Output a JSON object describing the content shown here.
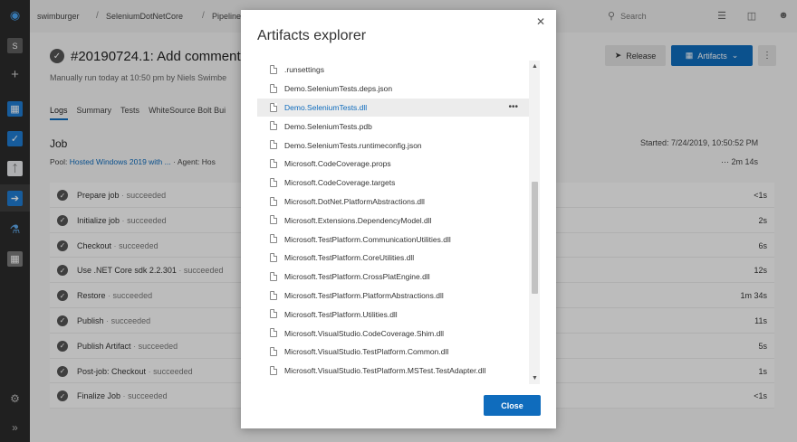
{
  "topbar": {
    "breadcrumbs": [
      "swimburger",
      "SeleniumDotNetCore",
      "Pipelines"
    ],
    "search_placeholder": "Search"
  },
  "run": {
    "title": "#20190724.1: Add comments t",
    "subtitle": "Manually run today at 10:50 pm by Niels Swimbe",
    "release_label": "Release",
    "artifacts_label": "Artifacts"
  },
  "tabs": [
    {
      "label": "Logs",
      "active": true
    },
    {
      "label": "Summary"
    },
    {
      "label": "Tests"
    },
    {
      "label": "WhiteSource Bolt Bui"
    }
  ],
  "job": {
    "title": "Job",
    "pool_label": "Pool:",
    "pool_value": "Hosted Windows 2019 with ...",
    "agent_label": "Agent: Hos",
    "started": "Started: 7/24/2019, 10:50:52 PM",
    "duration": "⋯ 2m 14s"
  },
  "steps": [
    {
      "name": "Prepare job",
      "status": "succeeded",
      "duration": "<1s"
    },
    {
      "name": "Initialize job",
      "status": "succeeded",
      "duration": "2s"
    },
    {
      "name": "Checkout",
      "status": "succeeded",
      "duration": "6s"
    },
    {
      "name": "Use .NET Core sdk 2.2.301",
      "status": "succeeded",
      "duration": "12s"
    },
    {
      "name": "Restore",
      "status": "succeeded",
      "duration": "1m 34s"
    },
    {
      "name": "Publish",
      "status": "succeeded",
      "duration": "11s"
    },
    {
      "name": "Publish Artifact",
      "status": "succeeded",
      "duration": "5s"
    },
    {
      "name": "Post-job: Checkout",
      "status": "succeeded",
      "duration": "1s"
    },
    {
      "name": "Finalize Job",
      "status": "succeeded",
      "duration": "<1s"
    }
  ],
  "modal": {
    "title": "Artifacts explorer",
    "close_label": "Close",
    "files": [
      ".runsettings",
      "Demo.SeleniumTests.deps.json",
      "Demo.SeleniumTests.dll",
      "Demo.SeleniumTests.pdb",
      "Demo.SeleniumTests.runtimeconfig.json",
      "Microsoft.CodeCoverage.props",
      "Microsoft.CodeCoverage.targets",
      "Microsoft.DotNet.PlatformAbstractions.dll",
      "Microsoft.Extensions.DependencyModel.dll",
      "Microsoft.TestPlatform.CommunicationUtilities.dll",
      "Microsoft.TestPlatform.CoreUtilities.dll",
      "Microsoft.TestPlatform.CrossPlatEngine.dll",
      "Microsoft.TestPlatform.PlatformAbstractions.dll",
      "Microsoft.TestPlatform.Utilities.dll",
      "Microsoft.VisualStudio.CodeCoverage.Shim.dll",
      "Microsoft.VisualStudio.TestPlatform.Common.dll",
      "Microsoft.VisualStudio.TestPlatform.MSTest.TestAdapter.dll"
    ],
    "selected_index": 2
  },
  "colors": {
    "accent": "#0f6cbd",
    "nav": "#2b2b2b"
  }
}
